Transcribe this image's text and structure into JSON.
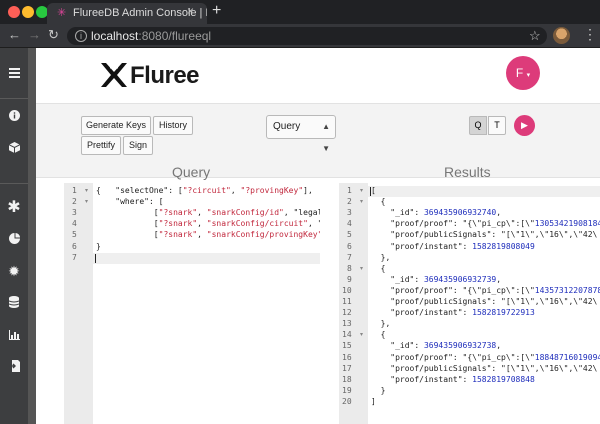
{
  "browser": {
    "tab_title": "FlureeDB Admin Console | Flure",
    "tab_close": "×",
    "new_tab": "+",
    "url_host": "localhost",
    "url_rest": ":8080/flureeql",
    "nav_back": "←",
    "nav_forward": "→",
    "nav_reload": "↻",
    "star": "☆",
    "menu": "⋮"
  },
  "sidebar": {
    "icons": [
      "menu-icon",
      "info-icon",
      "cube-icon",
      "asterisk-icon",
      "pie-chart-icon",
      "gear-icon",
      "database-icon",
      "bar-chart-icon",
      "import-icon"
    ]
  },
  "header": {
    "logo_text": "Fluree",
    "avatar_letter": "F",
    "avatar_caret": "▾"
  },
  "toolbar": {
    "generate_keys": "Generate Keys",
    "history": "History",
    "prettify": "Prettify",
    "sign": "Sign",
    "query_type": "Query",
    "q_label": "Q",
    "t_label": "T",
    "run": "▶"
  },
  "query_pane": {
    "title": "Query",
    "lines": [
      {
        "num": "1",
        "text": "{   \"selectOne\": [\"?circuit\", \"?provingKey\"],"
      },
      {
        "num": "2",
        "text": "    \"where\": ["
      },
      {
        "num": "3",
        "text": "            [\"?snark\", \"snarkConfig/id\", \"legalFi"
      },
      {
        "num": "4",
        "text": "            [\"?snark\", \"snarkConfig/circuit\", \"?c"
      },
      {
        "num": "5",
        "text": "            [\"?snark\", \"snarkConfig/provingKey\","
      },
      {
        "num": "6",
        "text": "}"
      },
      {
        "num": "7",
        "text": ""
      }
    ]
  },
  "results_pane": {
    "title": "Results",
    "lines": [
      {
        "num": "1",
        "text": "["
      },
      {
        "num": "2",
        "text": "  {"
      },
      {
        "num": "3",
        "text": "    \"_id\": 369435906932740,"
      },
      {
        "num": "4",
        "text": "    \"proof/proof\": \"{\\\"pi_cp\\\":[\\\"13053421908184"
      },
      {
        "num": "5",
        "text": "    \"proof/publicSignals\": \"[\\\"1\\\",\\\"16\\\",\\\"42\\"
      },
      {
        "num": "6",
        "text": "    \"proof/instant\": 1582819808049"
      },
      {
        "num": "7",
        "text": "  },"
      },
      {
        "num": "8",
        "text": "  {"
      },
      {
        "num": "9",
        "text": "    \"_id\": 369435906932739,"
      },
      {
        "num": "10",
        "text": "    \"proof/proof\": \"{\\\"pi_cp\\\":[\\\"14357312207878"
      },
      {
        "num": "11",
        "text": "    \"proof/publicSignals\": \"[\\\"1\\\",\\\"16\\\",\\\"42\\"
      },
      {
        "num": "12",
        "text": "    \"proof/instant\": 1582819722913"
      },
      {
        "num": "13",
        "text": "  },"
      },
      {
        "num": "14",
        "text": "  {"
      },
      {
        "num": "15",
        "text": "    \"_id\": 369435906932738,"
      },
      {
        "num": "16",
        "text": "    \"proof/proof\": \"{\\\"pi_cp\\\":[\\\"18848716019094"
      },
      {
        "num": "17",
        "text": "    \"proof/publicSignals\": \"[\\\"1\\\",\\\"16\\\",\\\"42\\"
      },
      {
        "num": "18",
        "text": "    \"proof/instant\": 1582819708848"
      },
      {
        "num": "19",
        "text": "  }"
      },
      {
        "num": "20",
        "text": "]"
      }
    ]
  },
  "colors": {
    "accent": "#dd3b7a",
    "string": "#c1273c",
    "number": "#1e2dbb"
  }
}
